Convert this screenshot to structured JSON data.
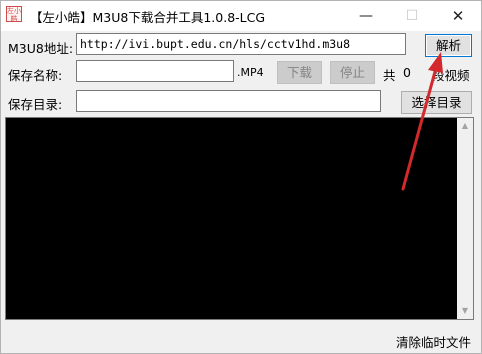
{
  "window": {
    "title": "【左小皓】M3U8下载合并工具1.0.8-LCG",
    "icon_text": "左小皓",
    "controls": {
      "minimize": "—",
      "maximize": "☐",
      "close": "✕"
    }
  },
  "form": {
    "url_label": "M3U8地址:",
    "url_value": "http://ivi.bupt.edu.cn/hls/cctv1hd.m3u8",
    "parse_button": "解析",
    "name_label": "保存名称:",
    "name_value": "",
    "ext_label": ".MP4",
    "download_button": "下载",
    "stop_button": "停止",
    "total_prefix": "共",
    "segment_count": "0",
    "segment_suffix": "段视频",
    "dir_label": "保存目录:",
    "dir_value": "",
    "choose_dir_button": "选择目录"
  },
  "console": {
    "text": ""
  },
  "footer": {
    "clear_temp_label": "清除临时文件"
  },
  "colors": {
    "annotation_arrow": "#d3282c",
    "console_bg": "#000000"
  }
}
